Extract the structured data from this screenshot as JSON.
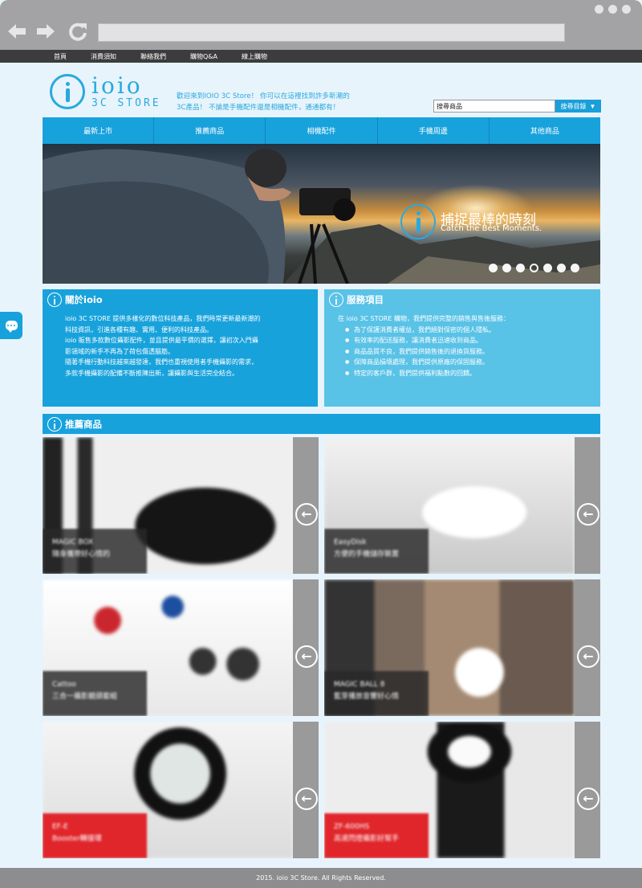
{
  "browser": {
    "address": ""
  },
  "top_links": [
    "首頁",
    "消費須知",
    "聯絡我們",
    "購物Q&A",
    "線上購物"
  ],
  "logo": {
    "name": "ioio",
    "sub": "3C STORE"
  },
  "tagline": [
    "歡迎來到IOIO 3C Store！ 你可以在這裡找到許多新潮的",
    "3C產品！ 不論是手機配件還是相機配件，通通都有！"
  ],
  "search": {
    "value": "搜尋商品",
    "button": "搜尋目錄"
  },
  "main_nav": [
    "最新上市",
    "推薦商品",
    "相機配件",
    "手機周邊",
    "其他商品"
  ],
  "hero": {
    "caption_zh": "捕捉最棒的時刻",
    "caption_en": "Catch the Best Moments.",
    "slide_count": 7,
    "active_slide": 4
  },
  "about": {
    "title": "關於ioio",
    "lines": [
      "ioio 3C STORE 提供多樣化的數位科技產品，我們時常更新最新潮的",
      "科技資訊，引進各種有趣、實用、便利的科技產品。",
      "ioio 販售多款數位攝影配件，並且提供最平價的選擇，讓初次入門攝",
      "影領域的新手不再為了荷包傷透腦筋。",
      "隨著手機行動科技越來越發達，我們也重視使用者手機攝影的需求，",
      "多款手機攝影的配備不斷推陳出新，讓攝影與生活完全結合。"
    ]
  },
  "service": {
    "title": "服務項目",
    "intro": "在 ioio 3C STORE 購物，我們提供完整的銷售與售後服務：",
    "items": [
      "為了保護消費者權益，我們絕對保密的個人隱私。",
      "有效率的配送服務，讓消費者迅速收到商品。",
      "商品品質不良，我們提供銷售後的退換貨服務。",
      "保障商品損壞處理，我們提供原廠的保固服務。",
      "特定的客戶群，我們提供福利點數的回饋。"
    ]
  },
  "recommend": {
    "title": "推薦商品",
    "products": [
      {
        "name": "MAGIC BOX",
        "desc": "隨身攜帶好心情的",
        "label_color": "dark"
      },
      {
        "name": "EasyDisk",
        "desc": "方便的手機儲存裝置",
        "label_color": "dark"
      },
      {
        "name": "Cattoo",
        "desc": "三合一攝影鏡頭套組",
        "label_color": "dark"
      },
      {
        "name": "MAGIC BALL 8",
        "desc": "藍芽播放音響好心情",
        "label_color": "dark"
      },
      {
        "name": "EF-E",
        "desc": "Booster轉接環",
        "label_color": "red"
      },
      {
        "name": "ZF-600HS",
        "desc": "高速閃燈攝影好幫手",
        "label_color": "red"
      }
    ]
  },
  "footer": "2015. ioio 3C Store. All Rights Reserved.",
  "colors": {
    "accent": "#18a2dc",
    "light_accent": "#59c2e7",
    "label_red": "#e0262b"
  }
}
